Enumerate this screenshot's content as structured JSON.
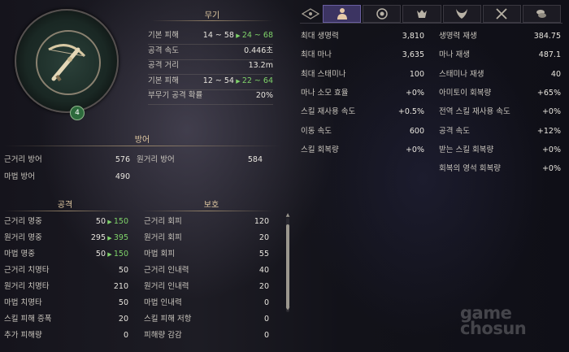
{
  "emblem": {
    "level": "4",
    "icon": "crossbow-icon"
  },
  "weapon": {
    "title": "무기",
    "rows": [
      {
        "label": "기본 피해",
        "before": "14 ~ 58",
        "after": "24 ~ 68"
      },
      {
        "label": "공격 속도",
        "value": "0.446초"
      },
      {
        "label": "공격 거리",
        "value": "13.2m"
      },
      {
        "label": "기본 피해",
        "before": "12 ~ 54",
        "after": "22 ~ 64"
      },
      {
        "label": "부무기 공격 확률",
        "value": "20%"
      }
    ]
  },
  "defense": {
    "title": "방어",
    "rows": [
      {
        "label": "근거리 방어",
        "value": "576"
      },
      {
        "label": "원거리 방어",
        "value": "584"
      },
      {
        "label": "마법 방어",
        "value": "490"
      }
    ]
  },
  "attack": {
    "title": "공격",
    "rows": [
      {
        "label": "근거리 명중",
        "before": "50",
        "after": "150"
      },
      {
        "label": "원거리 명중",
        "before": "295",
        "after": "395"
      },
      {
        "label": "마법 명중",
        "before": "50",
        "after": "150"
      },
      {
        "label": "근거리 치명타",
        "value": "50"
      },
      {
        "label": "원거리 치명타",
        "value": "210"
      },
      {
        "label": "마법 치명타",
        "value": "50"
      },
      {
        "label": "스킬 피해 증폭",
        "value": "20"
      },
      {
        "label": "추가 피해량",
        "value": "0"
      }
    ]
  },
  "protect": {
    "title": "보호",
    "rows": [
      {
        "label": "근거리 회피",
        "value": "120"
      },
      {
        "label": "원거리 회피",
        "value": "20"
      },
      {
        "label": "마법 회피",
        "value": "55"
      },
      {
        "label": "근거리 인내력",
        "value": "40"
      },
      {
        "label": "원거리 인내력",
        "value": "20"
      },
      {
        "label": "마법 인내력",
        "value": "0"
      },
      {
        "label": "스킬 피해 저항",
        "value": "0"
      },
      {
        "label": "피해량 감감",
        "value": "0"
      }
    ]
  },
  "tabs": [
    {
      "icon": "diamond-nav-icon"
    },
    {
      "icon": "character-icon"
    },
    {
      "icon": "orb-icon"
    },
    {
      "icon": "wolf-icon"
    },
    {
      "icon": "demon-icon"
    },
    {
      "icon": "crossed-swords-icon"
    },
    {
      "icon": "coins-icon"
    }
  ],
  "stats_left": [
    {
      "label": "최대 생명력",
      "value": "3,810"
    },
    {
      "label": "최대 마나",
      "value": "3,635"
    },
    {
      "label": "최대 스태미나",
      "value": "100"
    },
    {
      "label": "마나 소모 효율",
      "value": "+0%"
    },
    {
      "label": "스킬 재사용 속도",
      "value": "+0.5%"
    },
    {
      "label": "이동 속도",
      "value": "600"
    },
    {
      "label": "스킬 회복량",
      "value": "+0%"
    }
  ],
  "stats_right": [
    {
      "label": "생명력 재생",
      "value": "384.75"
    },
    {
      "label": "마나 재생",
      "value": "487.1"
    },
    {
      "label": "스태미나 재생",
      "value": "40"
    },
    {
      "label": "아미토이 회복량",
      "value": "+65%"
    },
    {
      "label": "전역 스킬 재사용 속도",
      "value": "+0%"
    },
    {
      "label": "공격 속도",
      "value": "+12%"
    },
    {
      "label": "받는 스킬 회복량",
      "value": "+0%"
    },
    {
      "label": "회복의 영석 회복량",
      "value": "+0%"
    }
  ],
  "watermark": {
    "line1": "game",
    "line2": "chosun"
  },
  "colors": {
    "accent_green": "#7fd36a",
    "header_gold": "#e1c9a2",
    "tab_active": "#3c3462"
  }
}
